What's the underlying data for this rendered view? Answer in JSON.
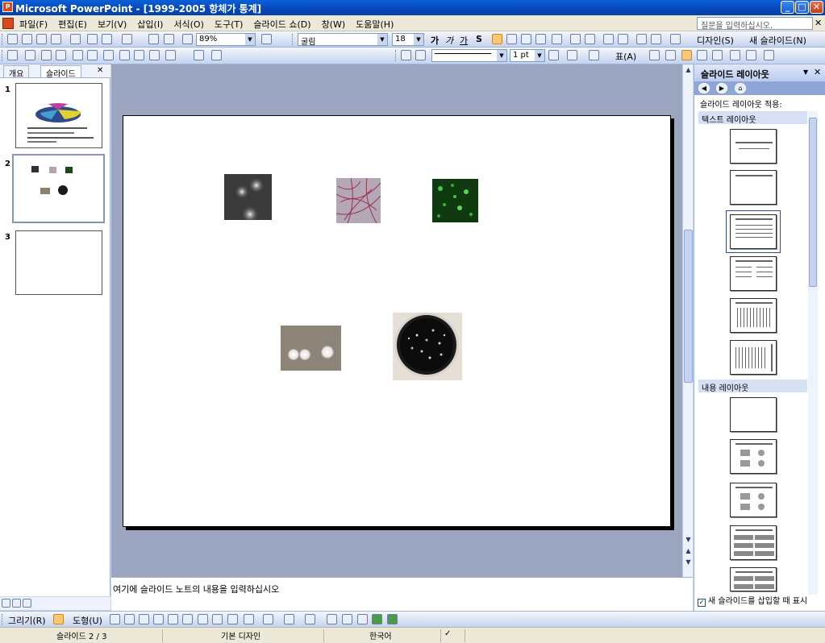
{
  "window": {
    "title": "Microsoft PowerPoint - [1999-2005 항체가 통계]"
  },
  "menu": {
    "items": [
      "파일(F)",
      "편집(E)",
      "보기(V)",
      "삽입(I)",
      "서식(O)",
      "도구(T)",
      "슬라이드 쇼(D)",
      "창(W)",
      "도움말(H)"
    ],
    "help_placeholder": "질문을 입력하십시오."
  },
  "toolbar": {
    "zoom": "89%",
    "font_name": "굴림",
    "font_size": "18",
    "bold": "가",
    "italic": "가",
    "underline": "가",
    "shadow": "S",
    "design_label": "디자인(S)",
    "new_slide_label": "새 슬라이드(N)",
    "line_weight": "1 pt",
    "table_label": "표(A)"
  },
  "left_panel": {
    "tabs": [
      "개요",
      "슬라이드"
    ],
    "active_tab": "슬라이드",
    "thumbnails": [
      {
        "number": "1"
      },
      {
        "number": "2"
      },
      {
        "number": "3"
      }
    ]
  },
  "notes": {
    "placeholder": "여기에 슬라이드 노트의 내용을 입력하십시오"
  },
  "task_pane": {
    "title": "슬라이드 레이아웃",
    "apply_label": "슬라이드 레이아웃 적용:",
    "section_text": "텍스트 레이아웃",
    "section_content": "내용 레이아웃",
    "footer_checkbox": "새 슬라이드를 삽입할 때 표시",
    "footer_checked": true
  },
  "drawing_toolbar": {
    "draw_label": "그리기(R)",
    "autoshape_label": "도형(U)"
  },
  "status": {
    "slide": "슬라이드 2 / 3",
    "design": "기본 디자인",
    "language": "한국어"
  },
  "colors": {
    "titlebar": "#0747b8",
    "slide_area_bg": "#9ca5c0",
    "task_section_bg": "#d5e0f5"
  }
}
